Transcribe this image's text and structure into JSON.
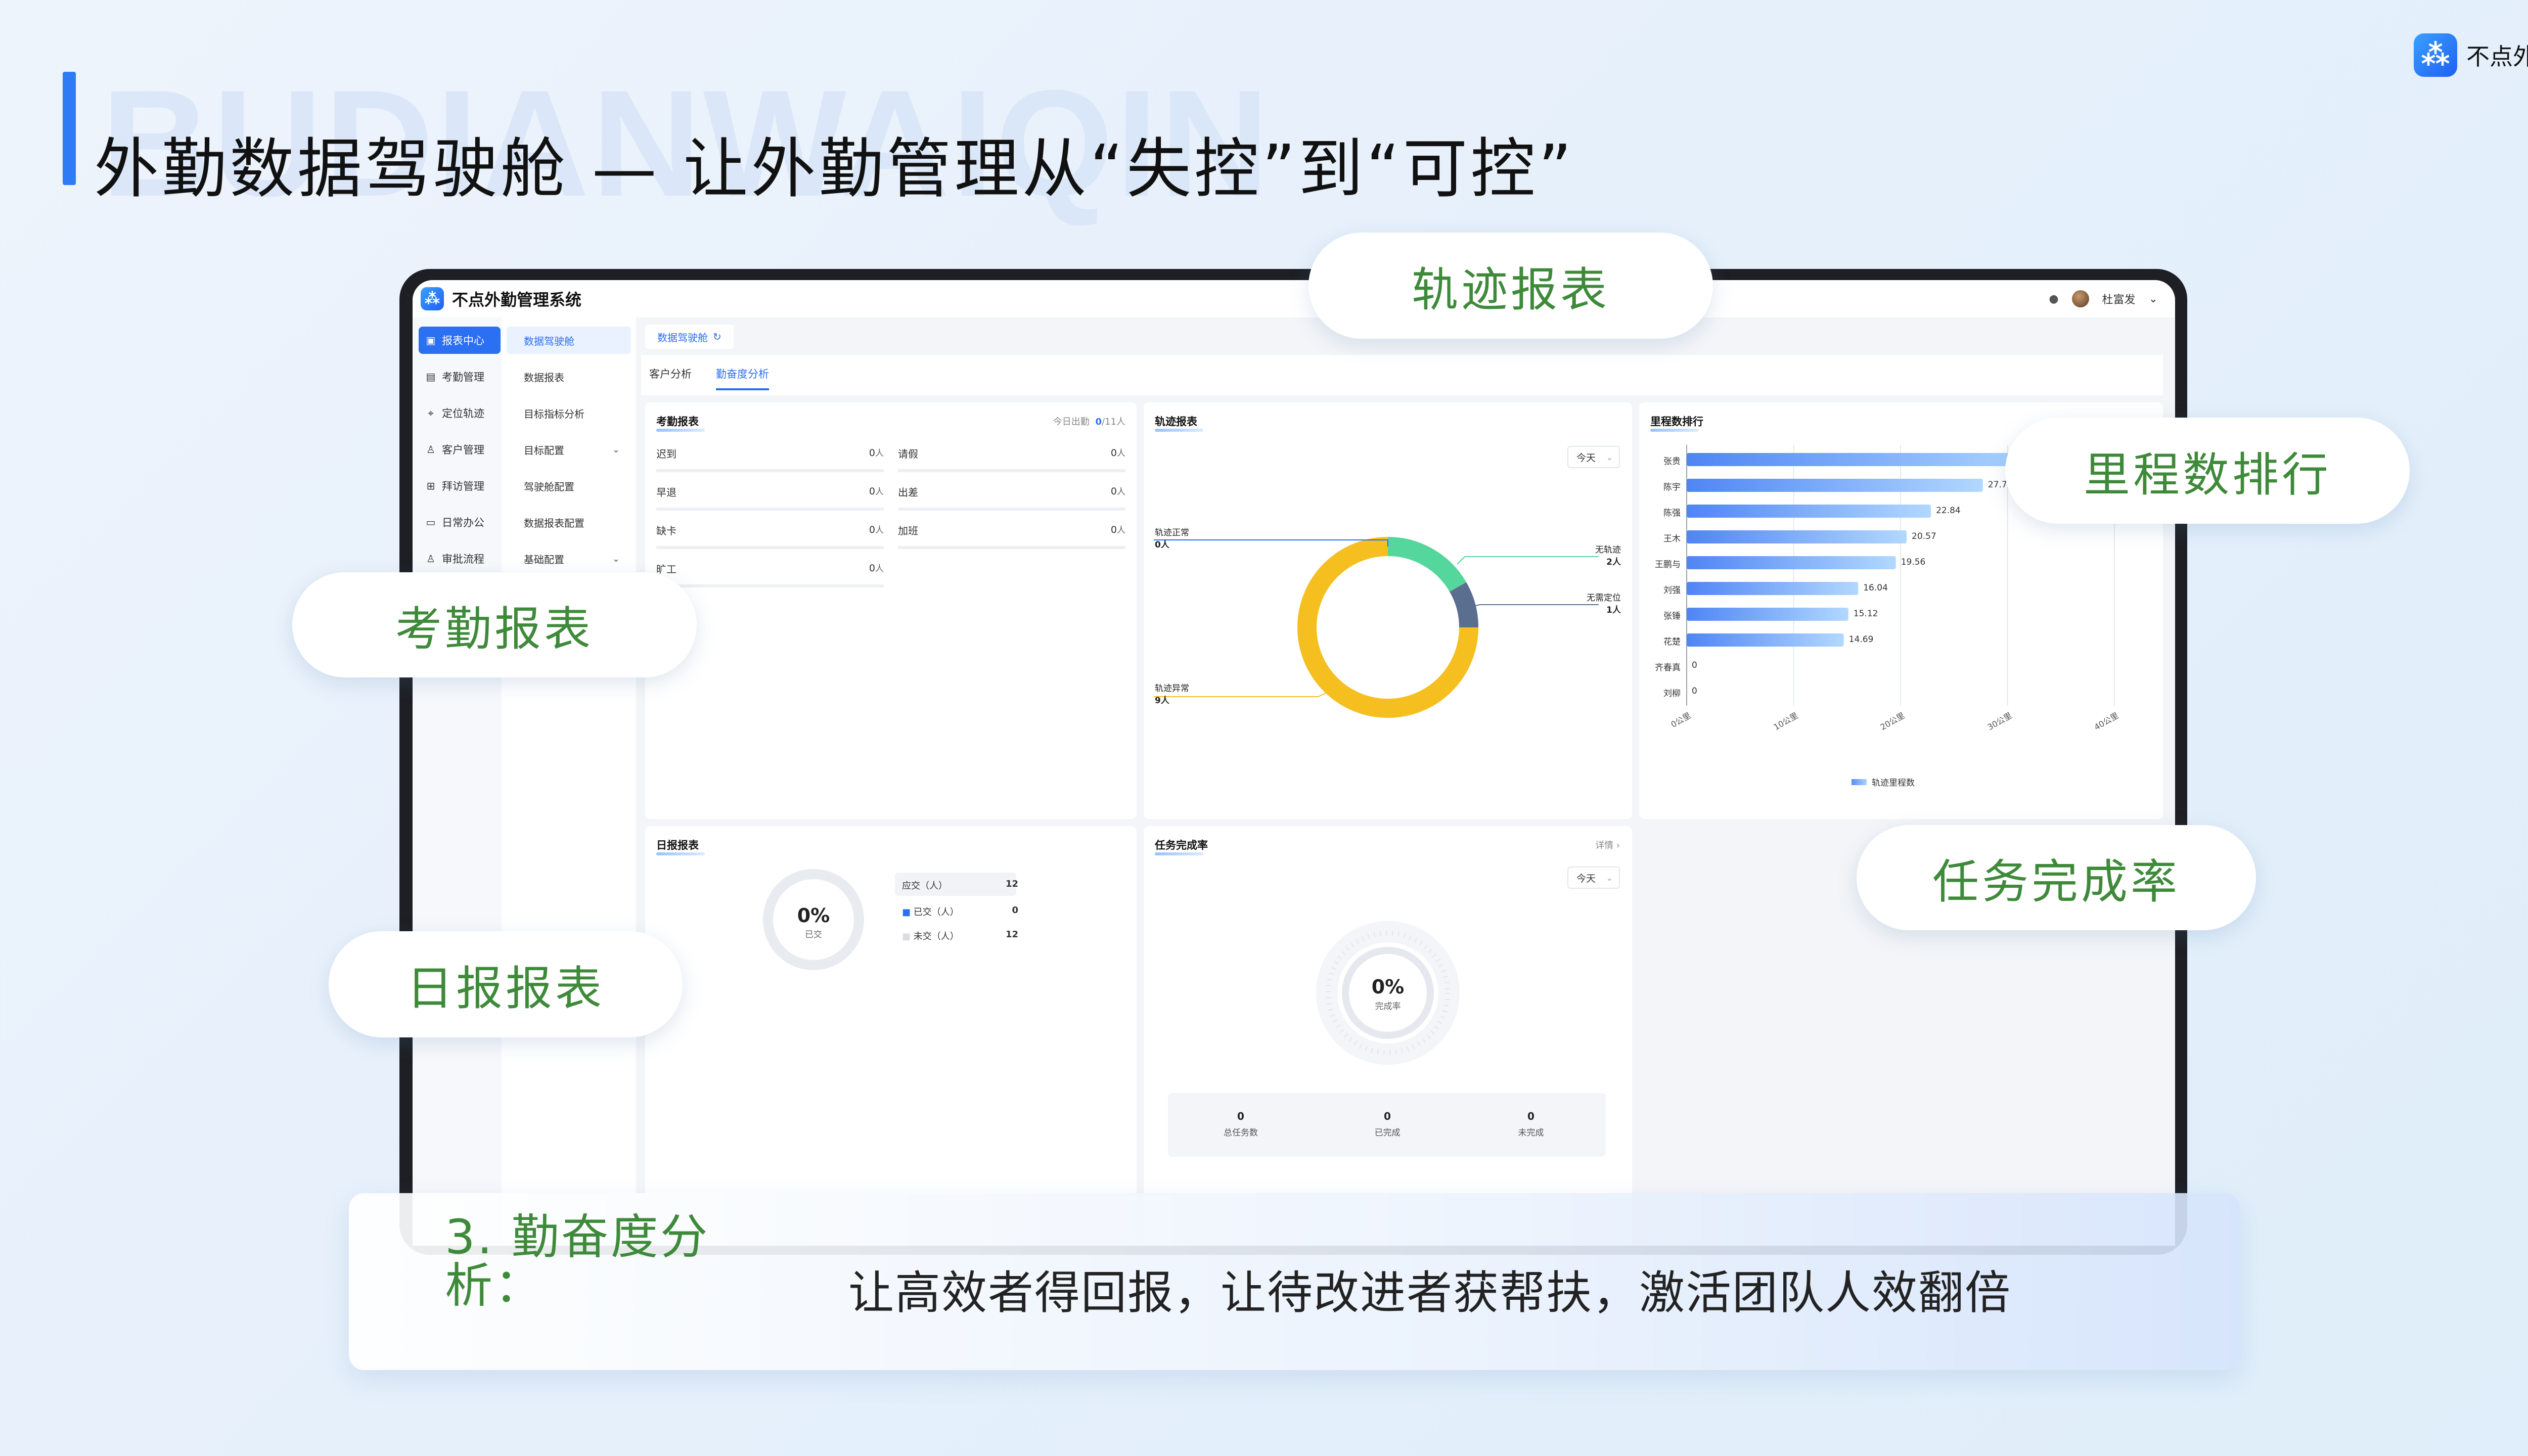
{
  "brand": {
    "logo_glyph": "⁂",
    "name": "不点外勤"
  },
  "slide": {
    "watermark": "BUDIANWAIQIN",
    "title": "外勤数据驾驶舱 — 让外勤管理从“失控”到“可控”"
  },
  "app": {
    "name": "不点外勤管理系统",
    "user": "杜富发",
    "sidebar": [
      {
        "label": "报表中心",
        "icon": "report-icon",
        "active": true
      },
      {
        "label": "考勤管理",
        "icon": "calendar-icon"
      },
      {
        "label": "定位轨迹",
        "icon": "location-icon"
      },
      {
        "label": "客户管理",
        "icon": "customer-icon"
      },
      {
        "label": "拜访管理",
        "icon": "visit-icon"
      },
      {
        "label": "日常办公",
        "icon": "monitor-icon"
      },
      {
        "label": "审批流程",
        "icon": "approval-icon"
      }
    ],
    "subnav": [
      {
        "label": "数据驾驶舱",
        "active": true
      },
      {
        "label": "数据报表"
      },
      {
        "label": "目标指标分析"
      },
      {
        "label": "目标配置",
        "caret": true
      },
      {
        "label": "驾驶舱配置"
      },
      {
        "label": "数据报表配置"
      },
      {
        "label": "基础配置",
        "caret": true
      }
    ],
    "page_tab": "数据驾驶舱",
    "subtabs": [
      "客户分析",
      "勤奋度分析"
    ]
  },
  "attendance": {
    "title": "考勤报表",
    "today_label": "今日出勤",
    "today_value": "0",
    "today_total": "/11人",
    "rows_left": [
      {
        "label": "迟到",
        "value": "0",
        "unit": "人"
      },
      {
        "label": "早退",
        "value": "0",
        "unit": "人"
      },
      {
        "label": "缺卡",
        "value": "0",
        "unit": "人"
      },
      {
        "label": "旷工",
        "value": "0",
        "unit": "人"
      }
    ],
    "rows_right": [
      {
        "label": "请假",
        "value": "0",
        "unit": "人"
      },
      {
        "label": "出差",
        "value": "0",
        "unit": "人"
      },
      {
        "label": "加班",
        "value": "0",
        "unit": "人"
      }
    ]
  },
  "track": {
    "title": "轨迹报表",
    "filter": "今天",
    "callouts": {
      "normal": {
        "label": "轨迹正常",
        "value": "0人"
      },
      "none": {
        "label": "无轨迹",
        "value": "2人"
      },
      "no_pos": {
        "label": "无需定位",
        "value": "1人"
      },
      "abnormal": {
        "label": "轨迹异常",
        "value": "9人"
      }
    }
  },
  "mileage": {
    "title": "里程数排行",
    "legend": "轨迹里程数",
    "x_ticks": [
      "0公里",
      "10公里",
      "20公里",
      "30公里",
      "40公里"
    ]
  },
  "daily": {
    "title": "日报报表",
    "pct": "0%",
    "pct_label": "已交",
    "rows": [
      {
        "label": "应交（人）",
        "value": "12"
      },
      {
        "label": "已交（人）",
        "value": "0"
      },
      {
        "label": "未交（人）",
        "value": "12"
      }
    ]
  },
  "task": {
    "title": "任务完成率",
    "detail": "详情 ›",
    "filter": "今天",
    "pct": "0%",
    "pct_label": "完成率",
    "stats": [
      {
        "value": "0",
        "label": "总任务数"
      },
      {
        "value": "0",
        "label": "已完成"
      },
      {
        "value": "0",
        "label": "未完成"
      }
    ]
  },
  "bubbles": {
    "track": "轨迹报表",
    "mileage": "里程数排行",
    "attendance": "考勤报表",
    "task": "任务完成率",
    "daily": "日报报表"
  },
  "caption": {
    "head": "3. 勤奋度分析：",
    "text": "让高效者得回报，让待改进者获帮扶，激活团队人效翻倍"
  },
  "colors": {
    "accent": "#2b6ff3",
    "green_text": "#3e8a3a",
    "donut_yellow": "#f5bf1f",
    "donut_green": "#55d69c",
    "donut_slate": "#5a6f8f"
  },
  "chart_data": [
    {
      "type": "pie",
      "title": "轨迹报表",
      "categories": [
        "轨迹正常",
        "无轨迹",
        "无需定位",
        "轨迹异常"
      ],
      "values": [
        0,
        2,
        1,
        9
      ],
      "unit": "人"
    },
    {
      "type": "bar",
      "orientation": "horizontal",
      "title": "里程数排行",
      "categories": [
        "张贵",
        "陈宇",
        "陈强",
        "王木",
        "王鹏与",
        "刘强",
        "张锤",
        "花楚",
        "齐春真",
        "刘柳"
      ],
      "values": [
        34,
        27.7,
        22.84,
        20.57,
        19.56,
        16.04,
        15.12,
        14.69,
        0,
        0
      ],
      "value_labels": [
        "",
        "27.7",
        "22.84",
        "20.57",
        "19.56",
        "16.04",
        "15.12",
        "14.69",
        "0",
        "0"
      ],
      "xlim": [
        0,
        40
      ],
      "series_name": "轨迹里程数"
    }
  ]
}
